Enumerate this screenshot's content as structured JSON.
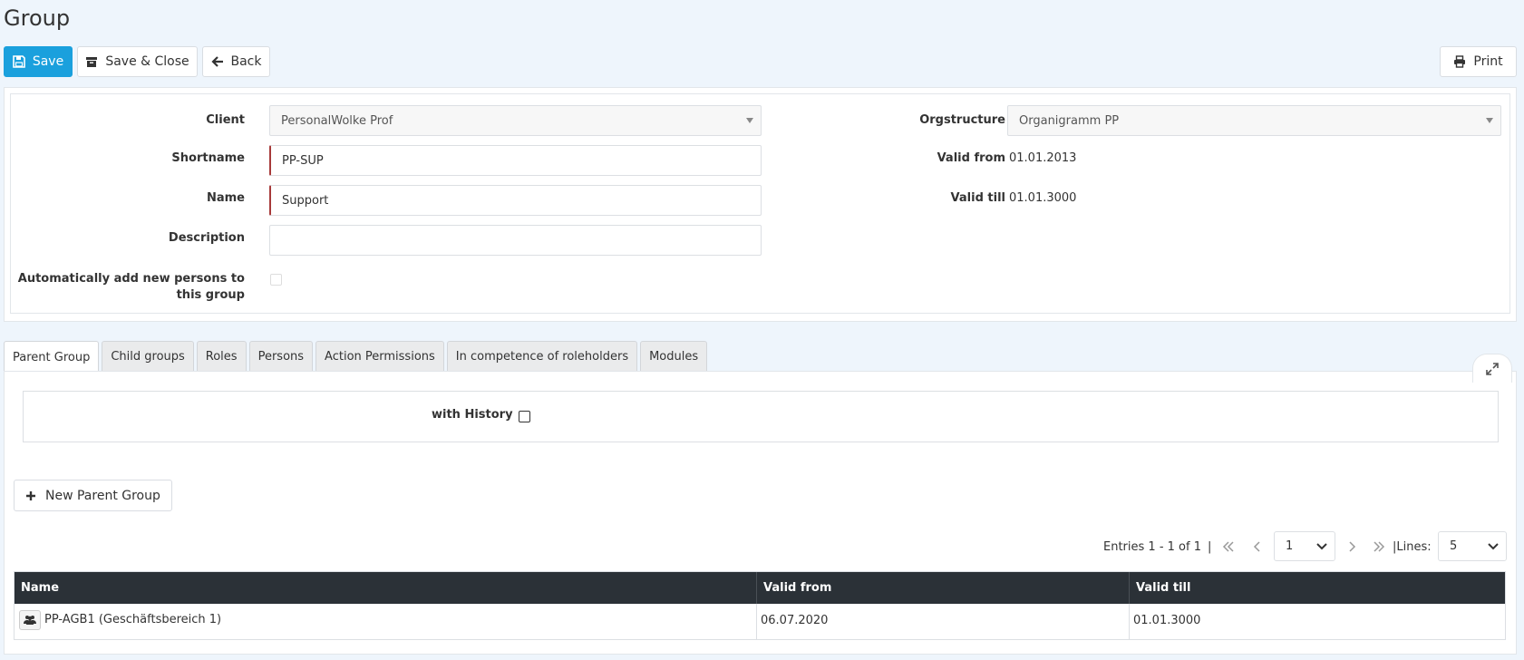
{
  "page": {
    "title": "Group"
  },
  "toolbar": {
    "save_label": "Save",
    "save_close_label": "Save & Close",
    "back_label": "Back",
    "print_label": "Print"
  },
  "form": {
    "client": {
      "label": "Client",
      "value": "PersonalWolke Prof"
    },
    "shortname": {
      "label": "Shortname",
      "value": "PP-SUP"
    },
    "name": {
      "label": "Name",
      "value": "Support"
    },
    "description": {
      "label": "Description",
      "value": ""
    },
    "auto_add": {
      "label_line1": "Automatically add new persons to",
      "label_line2": "this group",
      "checked": false
    },
    "orgstructure": {
      "label": "Orgstructure",
      "value": "Organigramm PP"
    },
    "valid_from": {
      "label": "Valid from",
      "value": "01.01.2013"
    },
    "valid_till": {
      "label": "Valid till",
      "value": "01.01.3000"
    }
  },
  "tabs": [
    {
      "label": "Parent Group",
      "active": true
    },
    {
      "label": "Child groups",
      "active": false
    },
    {
      "label": "Roles",
      "active": false
    },
    {
      "label": "Persons",
      "active": false
    },
    {
      "label": "Action Permissions",
      "active": false
    },
    {
      "label": "In competence of roleholders",
      "active": false
    },
    {
      "label": "Modules",
      "active": false
    }
  ],
  "parent_group": {
    "with_history_label": "with History",
    "with_history_checked": false,
    "new_button_label": "New Parent Group",
    "pager": {
      "entries_text": "Entries 1 - 1 of 1",
      "separator": "|",
      "page_value": "1",
      "lines_label": "|Lines:",
      "lines_value": "5"
    },
    "table": {
      "columns": [
        "Name",
        "Valid from",
        "Valid till"
      ],
      "rows": [
        {
          "name": "PP-AGB1 (Geschäftsbereich 1)",
          "valid_from": "06.07.2020",
          "valid_till": "01.01.3000",
          "icon": "users-icon"
        }
      ]
    }
  },
  "colors": {
    "primary": "#1aa0dd",
    "header_bg": "#2b3137",
    "page_bg": "#eef5fc",
    "required_marker": "#a73a3a"
  }
}
